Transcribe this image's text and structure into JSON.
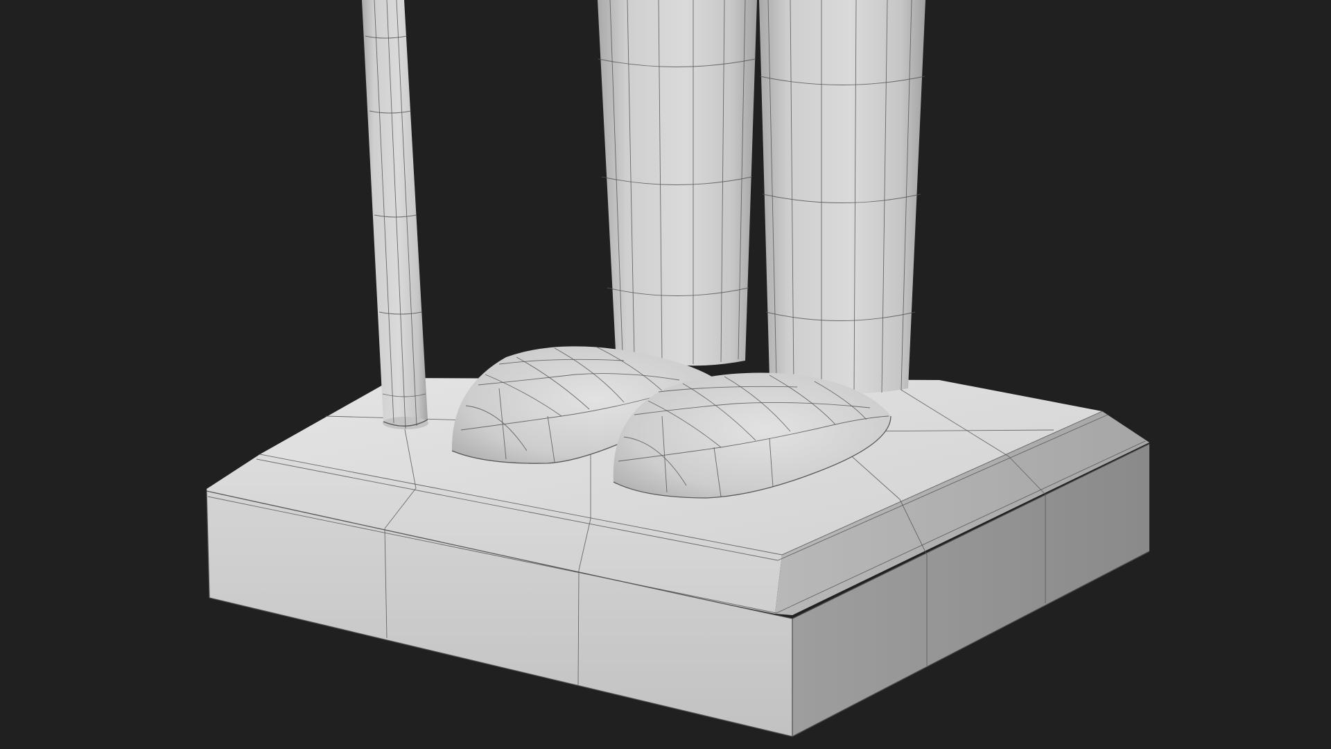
{
  "scene": {
    "background": "#202020",
    "model_color": "#d6d6d6",
    "wire_color": "#555555",
    "objects": [
      "rod",
      "left-leg",
      "right-leg",
      "left-shoe",
      "right-shoe",
      "pedestal-base"
    ]
  }
}
